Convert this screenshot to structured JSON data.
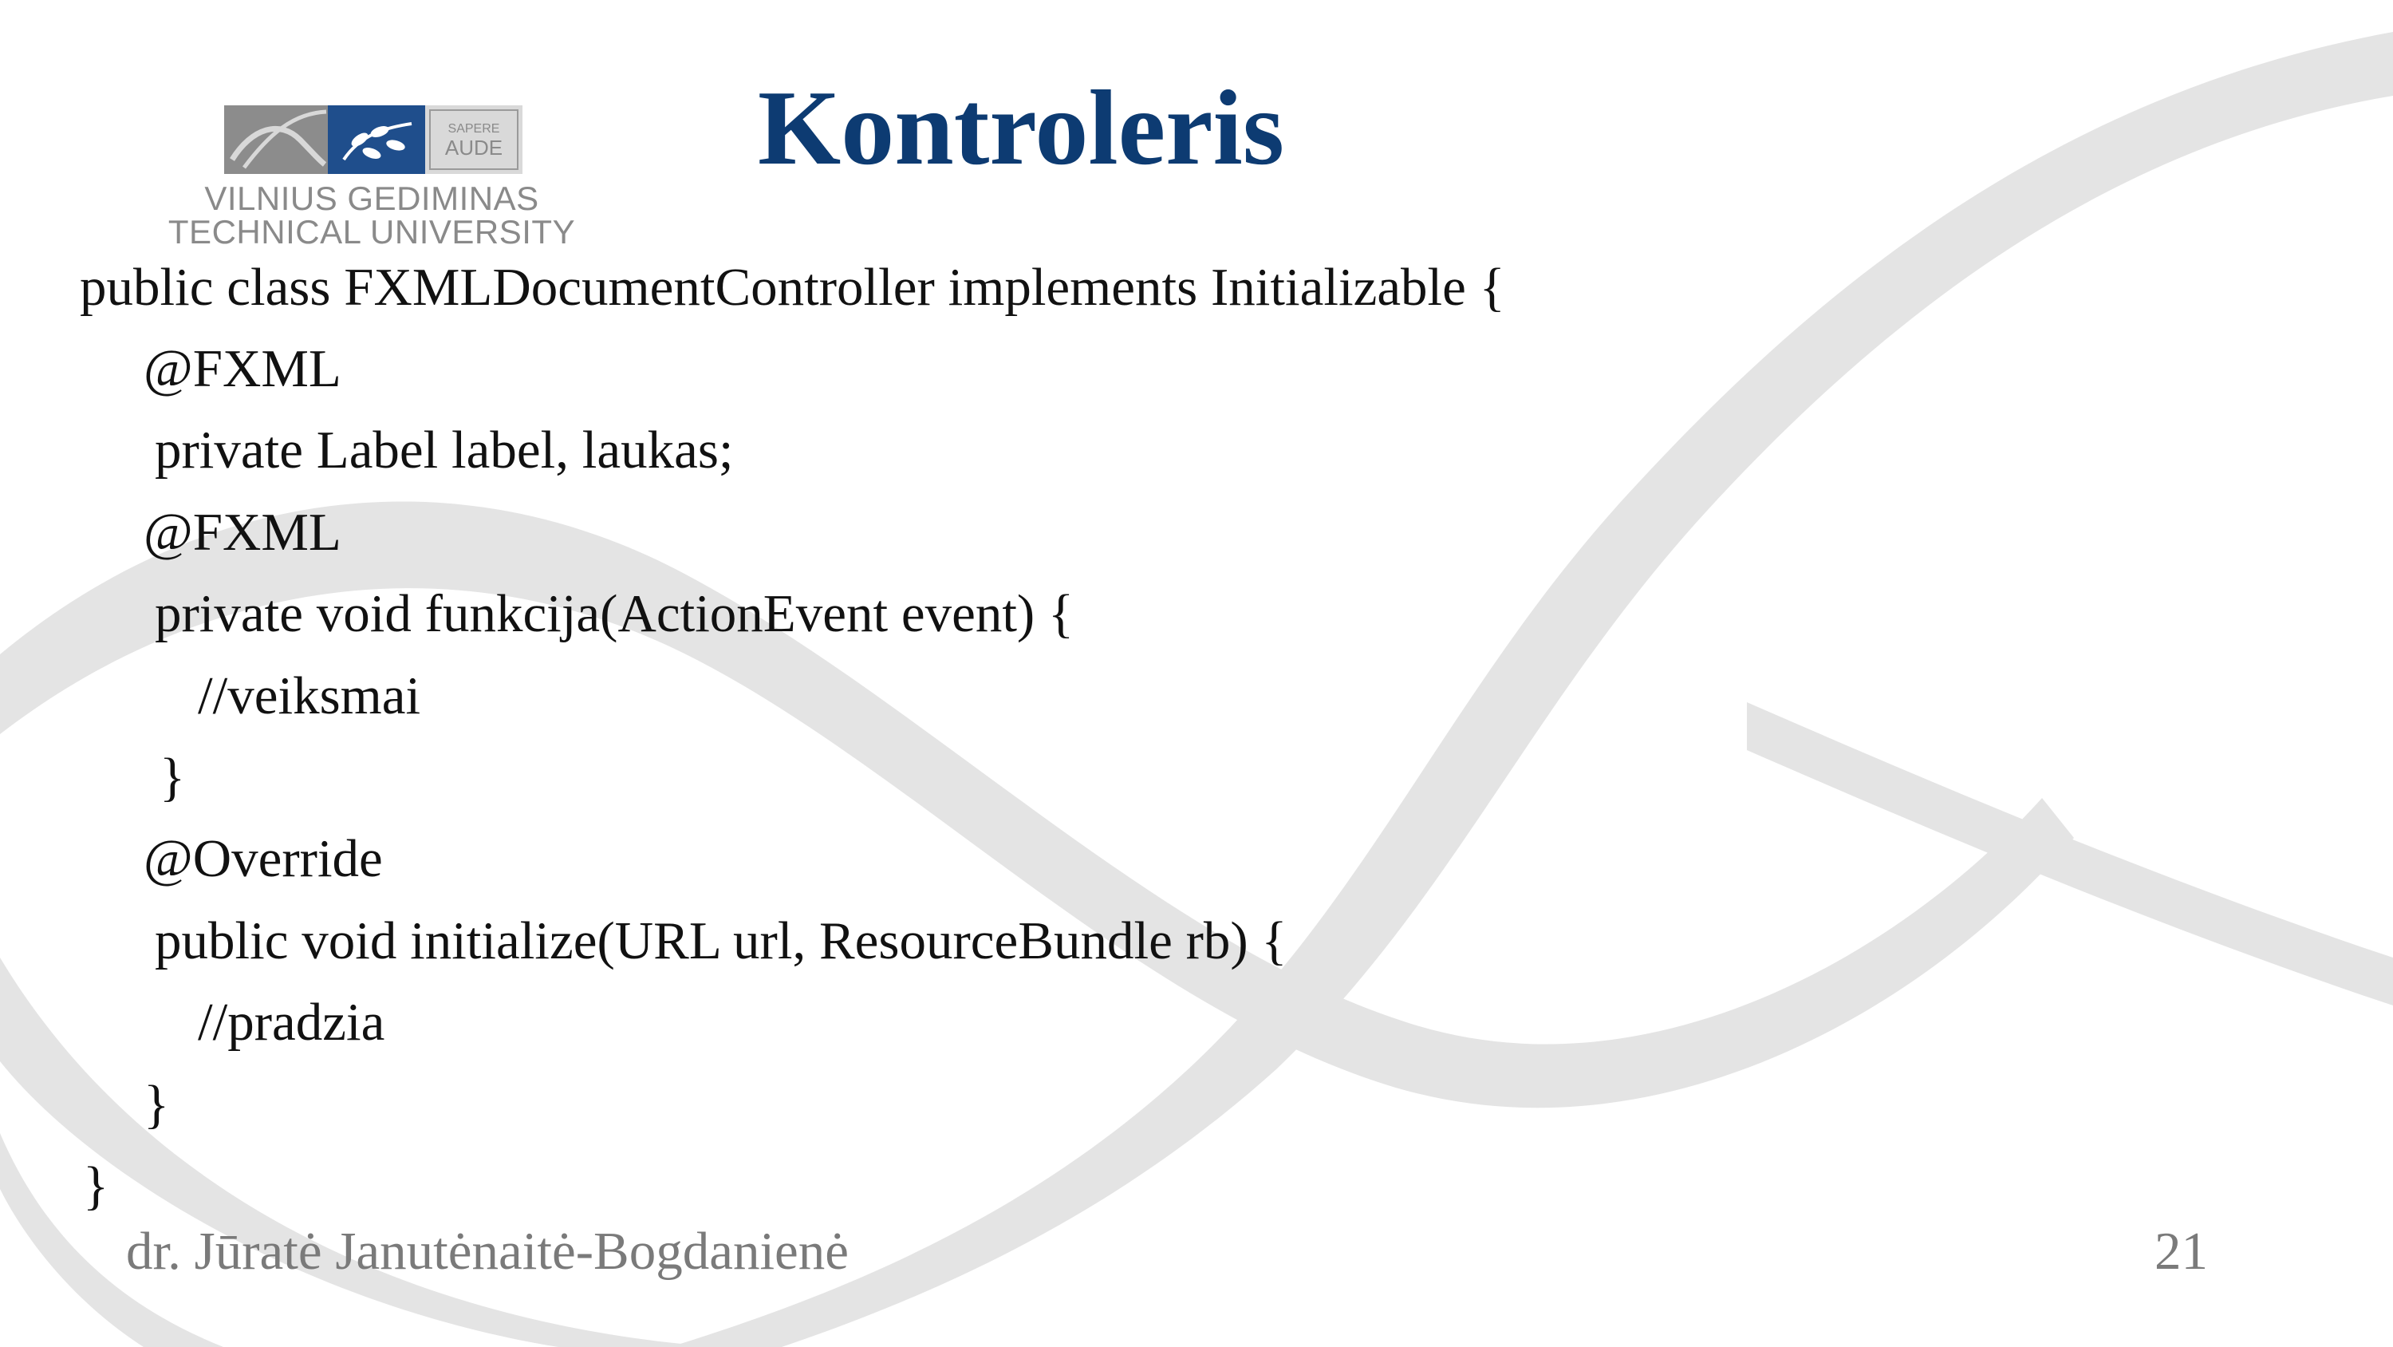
{
  "slide": {
    "title": "Kontroleris",
    "logo": {
      "line1": "VILNIUS GEDIMINAS",
      "line2": "TECHNICAL UNIVERSITY",
      "badge_line1": "SAPERE",
      "badge_line2": "AUDE"
    },
    "code_lines": [
      "public class FXMLDocumentController implements Initializable {",
      "@FXML",
      "private Label label, laukas;",
      "@FXML",
      "private void funkcija(ActionEvent event) {",
      "//veiksmai",
      "}",
      "@Override",
      "public void initialize(URL url, ResourceBundle rb) {",
      "//pradzia",
      "}",
      "}"
    ],
    "footer": {
      "author": "dr. Jūratė Janutėnaitė-Bogdanienė",
      "page_number": "21"
    },
    "colors": {
      "title": "#0d3b72",
      "watermark": "#e3e3e3",
      "logo_blue": "#1f4e8c",
      "logo_gray": "#8a8a8a",
      "footer": "#7a7a7a"
    }
  }
}
